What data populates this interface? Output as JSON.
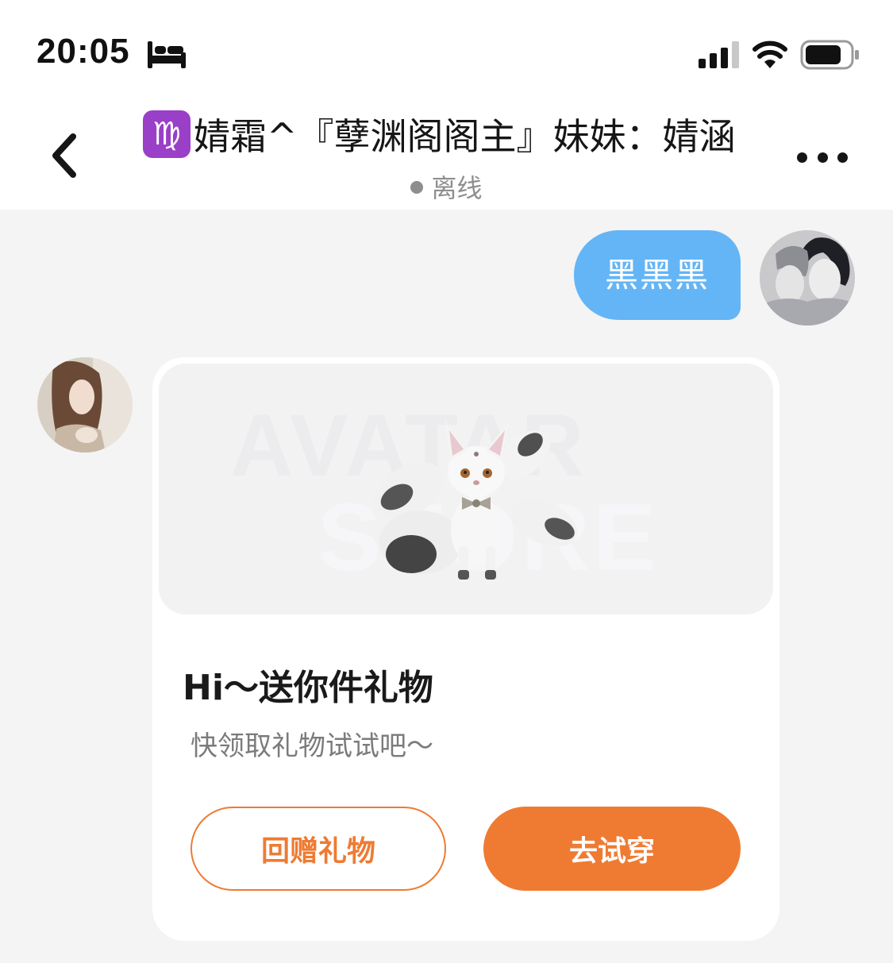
{
  "status_bar": {
    "time": "20:05",
    "icons": [
      "bed-icon",
      "cellular-signal-icon",
      "wifi-icon",
      "battery-icon"
    ]
  },
  "header": {
    "zodiac_icon": "♍",
    "title": "婧霜^『孽渊阁阁主』妹妹：婧涵",
    "status_text": "离线",
    "back_icon": "chevron-left-icon",
    "more_icon": "more-horizontal-icon"
  },
  "messages": [
    {
      "direction": "outgoing",
      "text": "黑黑黑"
    },
    {
      "direction": "incoming",
      "type": "gift-card",
      "title": "Hi～送你件礼物",
      "subtitle": "快领取礼物试试吧～",
      "watermark_line1": "AVATAR",
      "watermark_line2": "STORE",
      "return_gift_label": "回赠礼物",
      "try_on_label": "去试穿"
    }
  ],
  "colors": {
    "outgoing_bubble": "#64b5f6",
    "accent_orange": "#ef7b33",
    "page_bg": "#f4f4f4",
    "offline_gray": "#8e8e8e"
  }
}
